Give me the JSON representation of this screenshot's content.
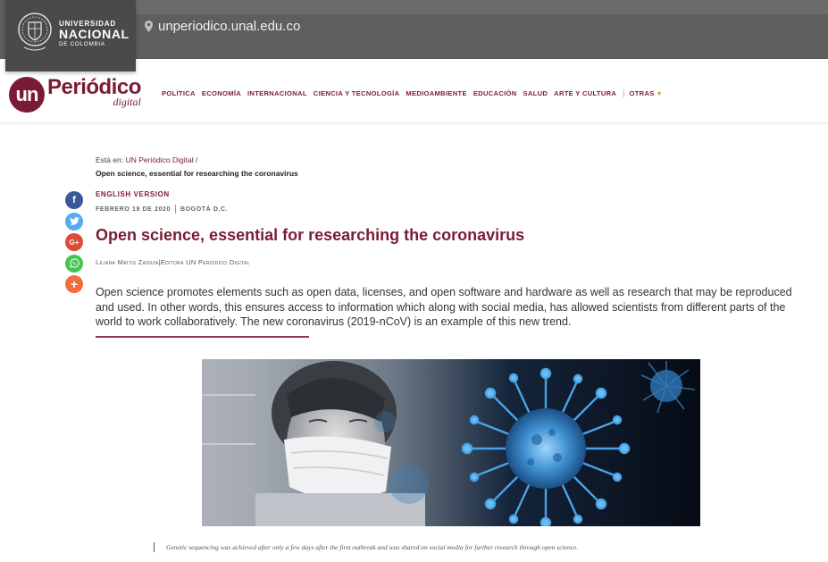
{
  "header": {
    "institution": {
      "line1": "UNIVERSIDAD",
      "line2": "NACIONAL",
      "line3": "DE COLOMBIA"
    },
    "url": "unperiodico.unal.edu.co",
    "brand": {
      "un": "un",
      "name": "Periódico",
      "sub": "digital"
    },
    "nav": [
      "POLÍTICA",
      "ECONOMÍA",
      "INTERNACIONAL",
      "CIENCIA Y TECNOLOGÍA",
      "MEDIOAMBIENTE",
      "EDUCACIÓN",
      "SALUD",
      "ARTE Y CULTURA"
    ],
    "nav_more": "OTRAS",
    "nav_more_icon": "chevron-down-icon"
  },
  "breadcrumb": {
    "prefix": "Está en:",
    "home": "UN Periódico Digital",
    "separator": "/",
    "current": "Open science, essential for researching the coronavirus"
  },
  "social": {
    "icons": [
      "facebook-icon",
      "twitter-icon",
      "google-plus-icon",
      "whatsapp-icon",
      "plus-icon"
    ],
    "facebook": "f",
    "twitter": "t",
    "google": "G+",
    "whatsapp": "w",
    "more": "+"
  },
  "article": {
    "section": "ENGLISH VERSION",
    "date": "FEBRERO 19 DE 2020",
    "place": "BOGOTÁ D.C.",
    "title": "Open science, essential for researching the coronavirus",
    "author": "Liliana Matos Zaidiza",
    "role": "Editora UN Periódico Digital",
    "lead": "Open science promotes elements such as open data, licenses, and open software and hardware as well as research that may be reproduced and used. In other words, this ensures access to information which along with social media, has allowed scientists from different parts of the world to work collaboratively. The new coronavirus (2019-nCoV) is an example of this new trend.",
    "caption": "Genetic sequencing was achieved after only a few days after the first outbreak and was shared on social media for further research through open science."
  },
  "colors": {
    "brand": "#7b1b33",
    "accent": "#c99a2e",
    "topbar": "#5e5e5e"
  }
}
